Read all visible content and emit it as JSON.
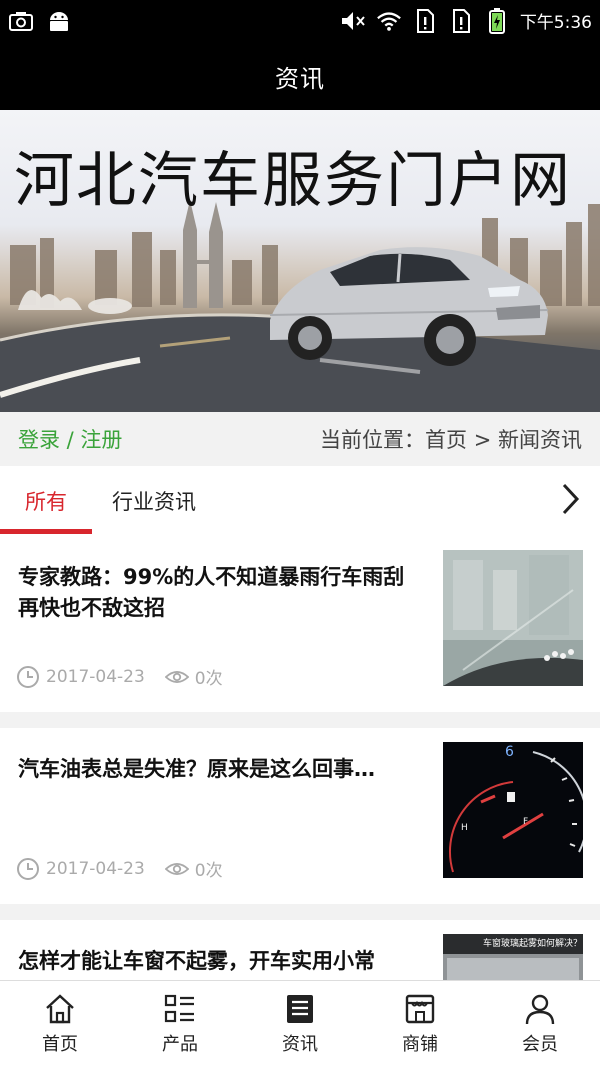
{
  "status_bar": {
    "time": "下午5:36",
    "left_icons": [
      "camera-icon",
      "android-icon"
    ],
    "right_icons": [
      "mute-icon",
      "wifi-icon",
      "sim-icon",
      "sim-icon",
      "battery-icon"
    ]
  },
  "header": {
    "title": "资讯"
  },
  "banner": {
    "title": "河北汽车服务门户网"
  },
  "location": {
    "login_label": "登录 / 注册",
    "breadcrumb": "当前位置：首页 > 新闻资讯"
  },
  "tabs": {
    "items": [
      {
        "label": "所有",
        "active": true
      },
      {
        "label": "行业资讯",
        "active": false
      }
    ],
    "more_icon": "chevron-right-icon"
  },
  "news": [
    {
      "title": "专家教路：99%的人不知道暴雨行车雨刮再快也不敌这招",
      "date": "2017-04-23",
      "views": "0次"
    },
    {
      "title": "汽车油表总是失准？原来是这么回事…",
      "date": "2017-04-23",
      "views": "0次"
    },
    {
      "title": "怎样才能让车窗不起雾，开车实用小常",
      "thumb_caption": "车窗玻璃起雾如何解决？"
    }
  ],
  "bottom_nav": [
    {
      "label": "首页",
      "icon": "home-icon"
    },
    {
      "label": "产品",
      "icon": "list-icon"
    },
    {
      "label": "资讯",
      "icon": "news-icon"
    },
    {
      "label": "商铺",
      "icon": "shop-icon"
    },
    {
      "label": "会员",
      "icon": "user-icon"
    }
  ],
  "colors": {
    "accent": "#d8262d",
    "login": "#3aa33a",
    "bar": "#000000"
  }
}
